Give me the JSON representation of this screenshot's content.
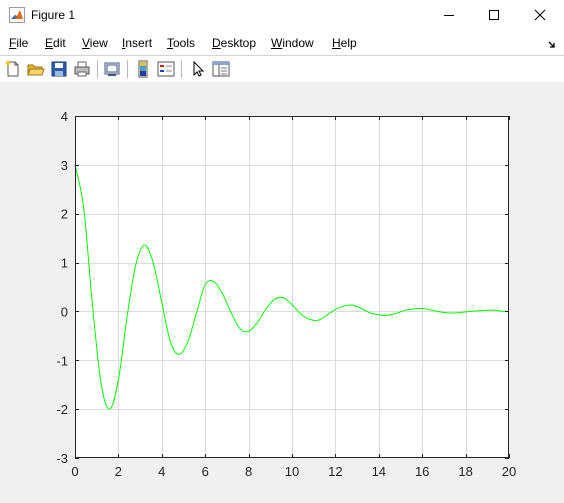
{
  "window": {
    "title": "Figure 1",
    "controls": [
      "minimize",
      "maximize",
      "close"
    ]
  },
  "menubar": {
    "items": [
      {
        "label": "File",
        "mnemonic": "F",
        "rest": "ile"
      },
      {
        "label": "Edit",
        "mnemonic": "E",
        "rest": "dit"
      },
      {
        "label": "View",
        "mnemonic": "V",
        "rest": "iew"
      },
      {
        "label": "Insert",
        "mnemonic": "I",
        "rest": "nsert"
      },
      {
        "label": "Tools",
        "mnemonic": "T",
        "rest": "ools"
      },
      {
        "label": "Desktop",
        "mnemonic": "D",
        "rest": "esktop"
      },
      {
        "label": "Window",
        "mnemonic": "W",
        "rest": "indow"
      },
      {
        "label": "Help",
        "mnemonic": "H",
        "rest": "elp"
      }
    ]
  },
  "toolbar": {
    "buttons": [
      "new-figure-icon",
      "open-file-icon",
      "save-icon",
      "print-icon",
      "link-plot-icon",
      "insert-colorbar-icon",
      "insert-legend-icon",
      "edit-plot-icon",
      "property-inspector-icon"
    ]
  },
  "chart_data": {
    "type": "line",
    "title": "",
    "xlabel": "",
    "ylabel": "",
    "xlim": [
      0,
      20
    ],
    "ylim": [
      -3,
      4
    ],
    "xticks": [
      "0",
      "2",
      "4",
      "6",
      "8",
      "10",
      "12",
      "14",
      "16",
      "18",
      "20"
    ],
    "yticks": [
      "-3",
      "-2",
      "-1",
      "0",
      "1",
      "2",
      "3",
      "4"
    ],
    "grid": true,
    "colors": {
      "line": "#00ff00",
      "axes_bg": "#ffffff",
      "grid": "#dcdcdc"
    },
    "series": [
      {
        "x": [
          0,
          0.4,
          0.8,
          1.2,
          1.6,
          2.0,
          2.4,
          2.8,
          3.2,
          3.6,
          4.0,
          4.4,
          4.8,
          5.2,
          5.6,
          6.0,
          6.4,
          6.8,
          7.2,
          7.6,
          8.0,
          8.4,
          8.8,
          9.2,
          9.6,
          10.0,
          10.4,
          10.8,
          11.2,
          11.6,
          12.0,
          12.4,
          12.8,
          13.2,
          13.6,
          14.0,
          14.4,
          14.8,
          15.2,
          15.6,
          16.0,
          16.4,
          16.8,
          17.2,
          17.6,
          18.0,
          18.4,
          18.8,
          19.2,
          19.6,
          20.0
        ],
        "y": [
          3.0,
          2.12,
          0.15,
          -1.47,
          -2.0,
          -1.4,
          -0.11,
          0.95,
          1.36,
          1.0,
          0.18,
          -0.63,
          -0.88,
          -0.62,
          -0.03,
          0.55,
          0.61,
          0.36,
          -0.03,
          -0.35,
          -0.41,
          -0.23,
          0.05,
          0.25,
          0.28,
          0.14,
          -0.05,
          -0.16,
          -0.18,
          -0.08,
          0.04,
          0.11,
          0.13,
          0.06,
          -0.03,
          -0.07,
          -0.08,
          -0.04,
          0.02,
          0.05,
          0.06,
          0.03,
          -0.01,
          -0.03,
          -0.03,
          -0.01,
          0.01,
          0.02,
          0.03,
          0.01,
          0.0
        ]
      }
    ]
  }
}
